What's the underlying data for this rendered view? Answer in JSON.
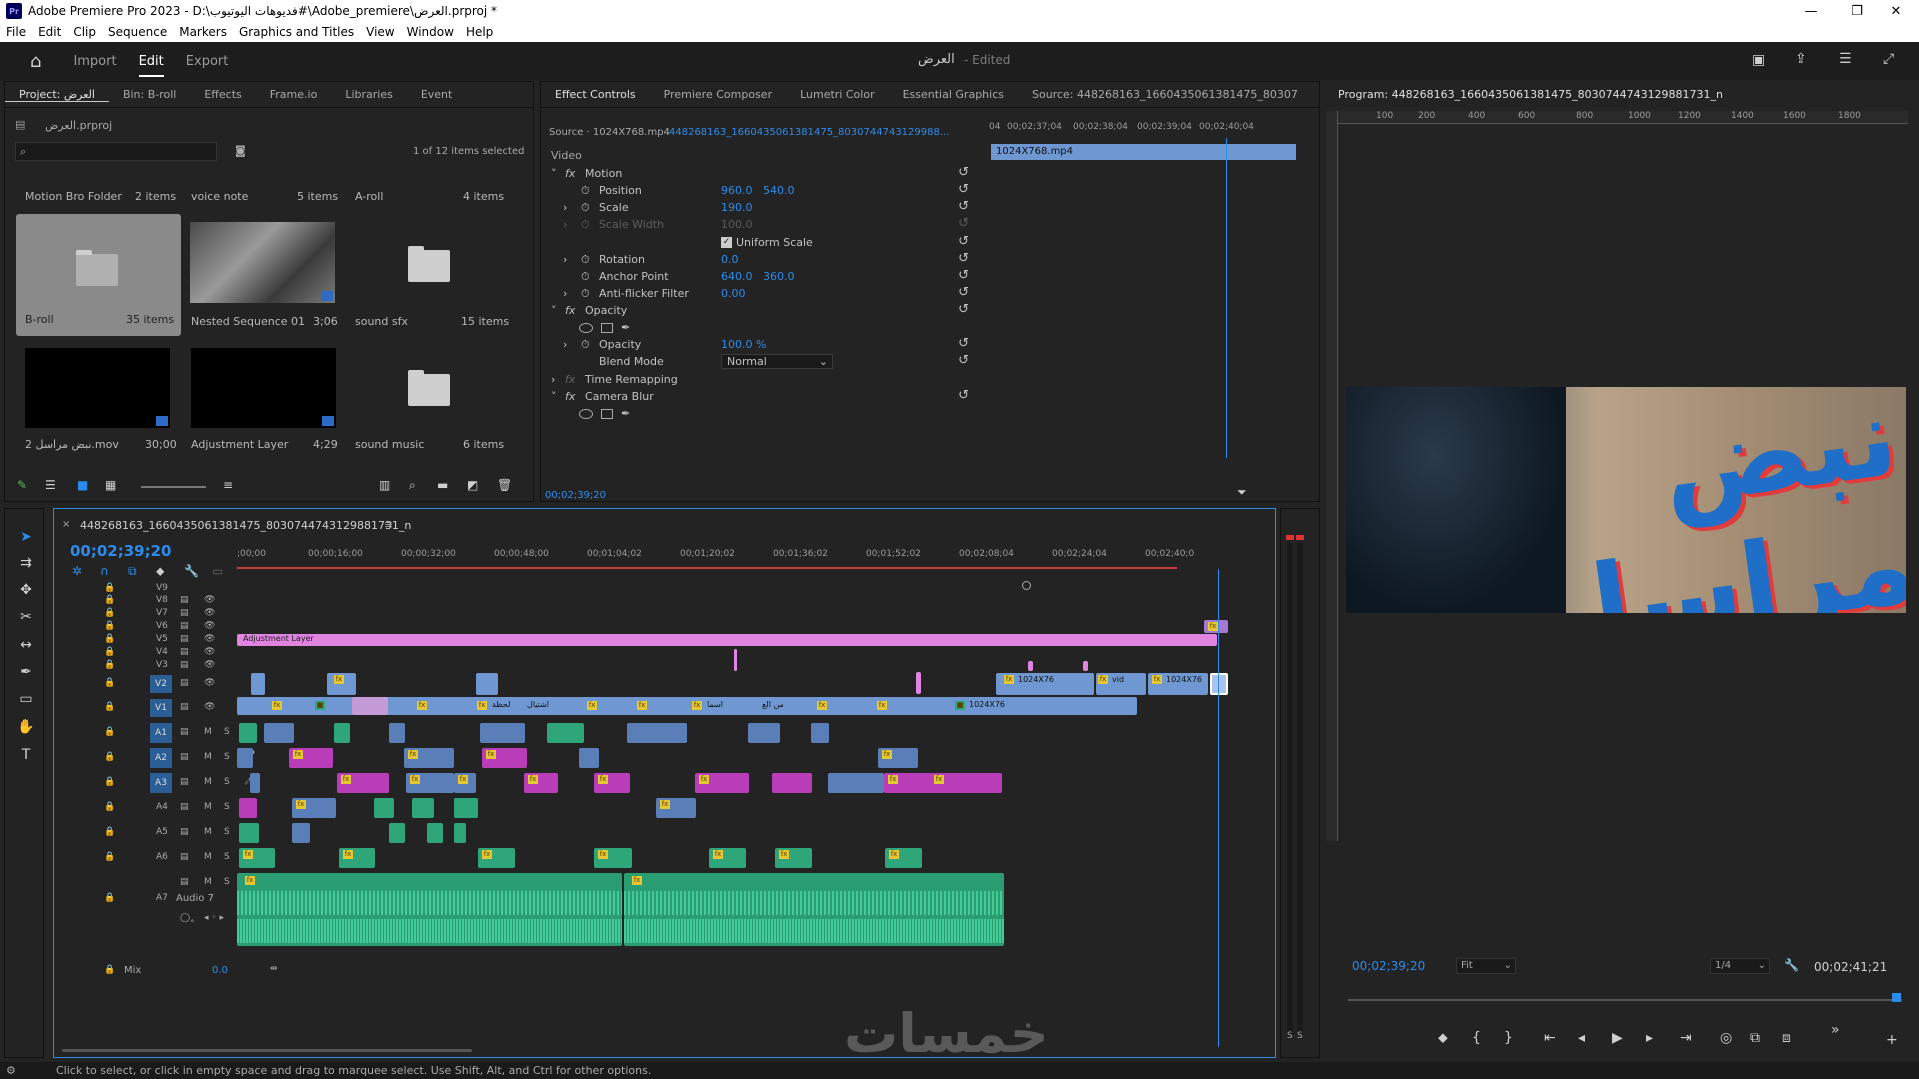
{
  "app": {
    "title": "Adobe Premiere Pro 2023 - D:\\فديوهات اليوتيوب#\\Adobe_premiere\\العرض.prproj *",
    "logo": "Pr",
    "window_controls": [
      "—",
      "❐",
      "✕"
    ]
  },
  "menu": [
    "File",
    "Edit",
    "Clip",
    "Sequence",
    "Markers",
    "Graphics and Titles",
    "View",
    "Window",
    "Help"
  ],
  "workspace": {
    "tabs": [
      "Import",
      "Edit",
      "Export"
    ],
    "active": "Edit",
    "project_title": "العرض",
    "edited_label": "- Edited"
  },
  "project_panel": {
    "tabs": [
      "Project: العرض",
      "Bin: B-roll",
      "Effects",
      "Frame.io",
      "Libraries",
      "Event"
    ],
    "project_file": "العرض.prproj",
    "search_placeholder": "",
    "selection_status": "1 of 12 items selected",
    "items": [
      {
        "name": "Motion Bro Folder",
        "meta": "2 items",
        "kind": "header"
      },
      {
        "name": "voice note",
        "meta": "5 items",
        "kind": "header"
      },
      {
        "name": "A-roll",
        "meta": "4 items",
        "kind": "header"
      },
      {
        "name": "B-roll",
        "meta": "35 items",
        "kind": "folder-selected"
      },
      {
        "name": "Nested Sequence 01",
        "meta": "3;06",
        "kind": "sequence"
      },
      {
        "name": "sound sfx",
        "meta": "15 items",
        "kind": "folder"
      },
      {
        "name": "نبض مراسل 2.mov",
        "meta": "30;00",
        "kind": "clip"
      },
      {
        "name": "Adjustment Layer",
        "meta": "4;29",
        "kind": "clip"
      },
      {
        "name": "sound music",
        "meta": "6 items",
        "kind": "folder"
      }
    ]
  },
  "effect_controls": {
    "tabs": [
      "Effect Controls",
      "Premiere Composer",
      "Lumetri Color",
      "Essential Graphics",
      "Source: 448268163_1660435061381475_80307"
    ],
    "source_label": "Source · 1024X768.mp4",
    "sequence_label": "448268163_1660435061381475_8030744743129988...",
    "ruler": [
      "04",
      "00;02;37;04",
      "00;02;38;04",
      "00;02;39;04",
      "00;02;40;04"
    ],
    "clip_label": "1024X768.mp4",
    "section_video": "Video",
    "rows": [
      {
        "label": "Motion",
        "type": "fx"
      },
      {
        "label": "Position",
        "v1": "960.0",
        "v2": "540.0"
      },
      {
        "label": "Scale",
        "v1": "190.0"
      },
      {
        "label": "Scale Width",
        "v1": "100.0",
        "disabled": true
      },
      {
        "label": "Uniform Scale",
        "type": "checkbox"
      },
      {
        "label": "Rotation",
        "v1": "0.0"
      },
      {
        "label": "Anchor Point",
        "v1": "640.0",
        "v2": "360.0"
      },
      {
        "label": "Anti-flicker Filter",
        "v1": "0.00"
      },
      {
        "label": "Opacity",
        "type": "fx"
      },
      {
        "label": "Opacity",
        "v1": "100.0 %"
      },
      {
        "label": "Blend Mode",
        "v1": "Normal",
        "type": "select"
      },
      {
        "label": "Time Remapping",
        "type": "fx-off"
      },
      {
        "label": "Camera Blur",
        "type": "fx"
      }
    ],
    "timecode": "00;02;39;20"
  },
  "program_monitor": {
    "title": "Program: 448268163_1660435061381475_8030744743129881731_n",
    "ruler": [
      "100",
      "200",
      "400",
      "600",
      "800",
      "1000",
      "1200",
      "1400",
      "1600",
      "1800"
    ],
    "timecode": "00;02;39;20",
    "fit": "Fit",
    "quality": "1/4",
    "duration": "00;02;41;21",
    "overlay_text": "نبض مراسل"
  },
  "timeline": {
    "sequence_name": "448268163_1660435061381475_8030744743129881731_n",
    "timecode": "00;02;39;20",
    "ruler": [
      ";00;00",
      "00;00;16;00",
      "00;00;32;00",
      "00;00;48;00",
      "00;01;04;02",
      "00;01;20;02",
      "00;01;36;02",
      "00;01;52;02",
      "00;02;08;04",
      "00;02;24;04",
      "00;02;40;0"
    ],
    "video_tracks": [
      "V9",
      "V8",
      "V7",
      "V6",
      "V5",
      "V4",
      "V3",
      "V2",
      "V1"
    ],
    "audio_tracks": [
      "A1",
      "A2",
      "A3",
      "A4",
      "A5",
      "A6",
      "A7"
    ],
    "audio7_label": "Audio 7",
    "mix_label": "Mix",
    "mix_value": "0.0",
    "clip_labels": {
      "adjustment": "Adjustment Layer",
      "v2a": "1024X76",
      "v2b": "vid",
      "v2c": "1024X76",
      "v1end": "1024X76",
      "v1a": "لحظة",
      "v1b": "اشتيال",
      "v1c": "اسما",
      "v1d": "من الع"
    },
    "track_buttons": {
      "mute": "M",
      "solo": "S"
    }
  },
  "meters": {
    "labels": [
      "S",
      "S"
    ]
  },
  "status_bar": {
    "text": "Click to select, or click in empty space and drag to marquee select. Use Shift, Alt, and Ctrl for other options."
  },
  "watermark": "خمسات",
  "colors": {
    "accent": "#2d8ceb",
    "adjust": "#e084e0",
    "video": "#6f98d2",
    "audio_green": "#2ea67a",
    "audio_purple": "#b93cb9",
    "audio_blue": "#5a7fb8"
  }
}
